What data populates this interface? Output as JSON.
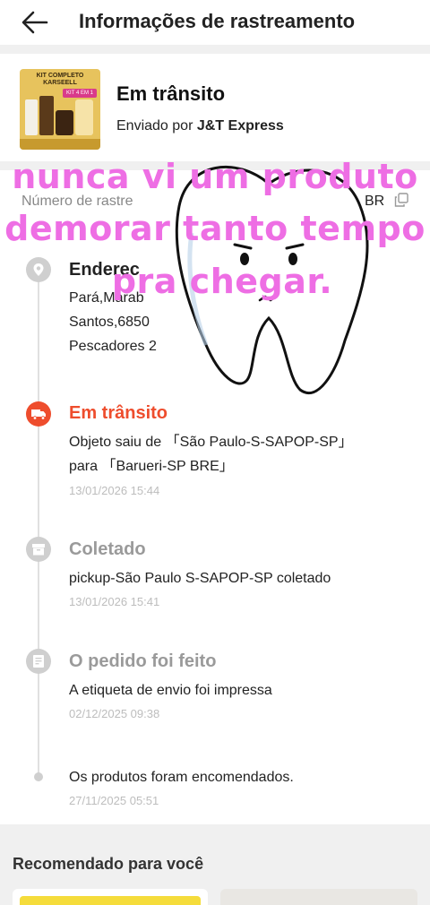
{
  "header": {
    "title": "Informações de rastreamento"
  },
  "order": {
    "status": "Em trânsito",
    "carrier_prefix": "Enviado por",
    "carrier_name": "J&T Express",
    "thumb_text_1": "KIT COMPLETO",
    "thumb_text_2": "KARSEELL",
    "thumb_badge": "KIT 4 EM 1"
  },
  "tracking": {
    "label": "Número de rastre",
    "suffix": "BR"
  },
  "timeline": [
    {
      "title": "Enderec",
      "lines": [
        "Pará,Marab",
        "Santos,6850",
        "Pescadores 2"
      ],
      "time": ""
    },
    {
      "title": "Em trânsito",
      "lines": [
        "Objeto saiu de 「São Paulo-S-SAPOP-SP」",
        "para 「Barueri-SP BRE」"
      ],
      "time": "13/01/2026 15:44"
    },
    {
      "title": "Coletado",
      "lines": [
        "pickup-São Paulo S-SAPOP-SP coletado"
      ],
      "time": "13/01/2026 15:41"
    },
    {
      "title": "O pedido foi feito",
      "lines": [
        "A etiqueta de envio foi impressa"
      ],
      "time": "02/12/2025 09:38"
    },
    {
      "title": "",
      "lines": [
        "Os produtos foram encomendados."
      ],
      "time": "27/11/2025 05:51"
    }
  ],
  "recommend": {
    "title": "Recomendado para você"
  },
  "overlay": {
    "caption_lines": [
      "nunca  vi um produto",
      "demorar tanto tempo",
      "pra chegar."
    ],
    "caption_color": "#ee6ee4"
  },
  "colors": {
    "accent": "#ee4d2d",
    "muted": "#9a9a9a"
  }
}
